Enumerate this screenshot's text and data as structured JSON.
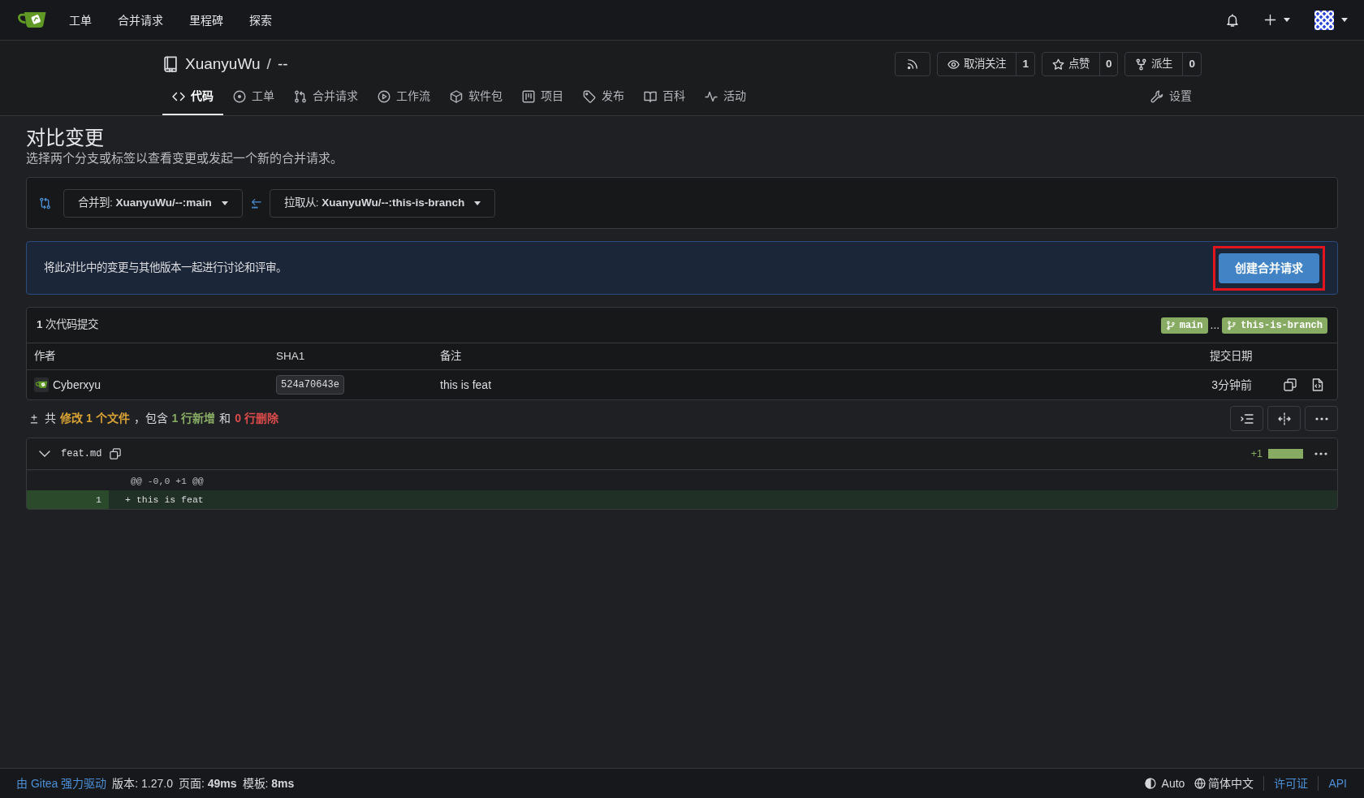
{
  "navbar": {
    "links": [
      {
        "label": "工单"
      },
      {
        "label": "合并请求"
      },
      {
        "label": "里程碑"
      },
      {
        "label": "探索"
      }
    ]
  },
  "repo": {
    "owner": "XuanyuWu",
    "separator": "/",
    "name": "--",
    "actions": [
      {
        "kind": "watch",
        "label": "取消关注",
        "count": "1"
      },
      {
        "kind": "star",
        "label": "点赞",
        "count": "0"
      },
      {
        "kind": "fork",
        "label": "派生",
        "count": "0"
      }
    ],
    "tabs": [
      {
        "kind": "code",
        "label": "代码",
        "selected": true
      },
      {
        "kind": "issues",
        "label": "工单",
        "selected": false
      },
      {
        "kind": "pulls",
        "label": "合并请求",
        "selected": false
      },
      {
        "kind": "actions",
        "label": "工作流",
        "selected": false
      },
      {
        "kind": "packages",
        "label": "软件包",
        "selected": false
      },
      {
        "kind": "projects",
        "label": "项目",
        "selected": false
      },
      {
        "kind": "releases",
        "label": "发布",
        "selected": false
      },
      {
        "kind": "wiki",
        "label": "百科",
        "selected": false
      },
      {
        "kind": "activity",
        "label": "活动",
        "selected": false
      }
    ],
    "settings_tab": {
      "kind": "settings",
      "label": "设置",
      "selected": false
    }
  },
  "page": {
    "title": "对比变更",
    "subtitle": "选择两个分支或标签以查看变更或发起一个新的合并请求。"
  },
  "compare": {
    "base": "合并到: **XuanyuWu/--:main**",
    "head": "拉取从: **XuanyuWu/--:this-is-branch**"
  },
  "notice": {
    "message": "将此对比中的变更与其他版本一起进行讨论和评审。",
    "button": {
      "label": "创建合并请求",
      "highlighted": true
    }
  },
  "commits": {
    "title": "**1** 次代码提交",
    "base_branch": "main",
    "separator": "...",
    "head_branch": "this-is-branch",
    "columns": [
      "作者",
      "SHA1",
      "备注",
      "提交日期"
    ],
    "rows": [
      {
        "author": "Cyberxyu",
        "sha": "524a70643e",
        "message": "this is feat",
        "date": "3分钟前"
      }
    ]
  },
  "diff_summary": [
    {
      "kind": "plain",
      "text": "共"
    },
    {
      "kind": "changed",
      "text": "修改 1 个文件"
    },
    {
      "kind": "plain",
      "text": "，包含"
    },
    {
      "kind": "added",
      "text": "1 行新增"
    },
    {
      "kind": "plain",
      "text": "和"
    },
    {
      "kind": "deleted",
      "text": "0 行删除"
    }
  ],
  "files": [
    {
      "name": "feat.md",
      "expanded": true,
      "additions": "+1",
      "lines": [
        {
          "kind": "hunk",
          "text": "@@ -0,0 +1 @@"
        },
        {
          "kind": "add",
          "number": "1",
          "sign": "+",
          "text": "this is feat"
        }
      ]
    }
  ],
  "footer": {
    "powered": "由 Gitea 强力驱动",
    "version": "版本: 1.27.0",
    "page_time": "页面: **49ms**",
    "template_time": "模板: **8ms**",
    "theme": "Auto",
    "language": "简体中文",
    "links": [
      "许可证",
      "API"
    ]
  }
}
